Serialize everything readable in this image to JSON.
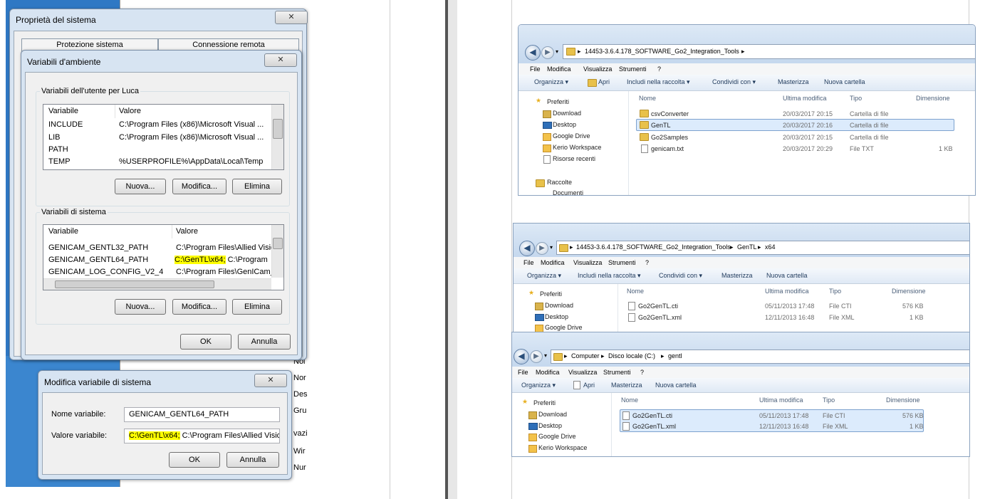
{
  "sysprops": {
    "title": "Proprietà del sistema",
    "close": "✕",
    "tabs": [
      "Protezione sistema",
      "Connessione remota"
    ]
  },
  "envvars": {
    "title": "Variabili d'ambiente",
    "close": "✕",
    "user_group": "Variabili dell'utente per Luca",
    "user_headers": [
      "Variabile",
      "Valore"
    ],
    "user_rows": [
      {
        "name": "INCLUDE",
        "value": "C:\\Program Files (x86)\\Microsoft Visual ..."
      },
      {
        "name": "LIB",
        "value": "C:\\Program Files (x86)\\Microsoft Visual ..."
      },
      {
        "name": "PATH",
        "value": ""
      },
      {
        "name": "TEMP",
        "value": "%USERPROFILE%\\AppData\\Local\\Temp"
      }
    ],
    "user_buttons": [
      "Nuova...",
      "Modifica...",
      "Elimina"
    ],
    "sys_group": "Variabili di sistema",
    "sys_headers": [
      "Variabile",
      "Valore"
    ],
    "sys_rows": [
      {
        "name": "GENICAM_GENTL32_PATH",
        "value": "C:\\Program Files\\Allied Visio"
      },
      {
        "name": "GENICAM_GENTL64_PATH",
        "value_hl": "C:\\GenTL\\x64;",
        "value_rest": " C:\\Program"
      },
      {
        "name": "GENICAM_LOG_CONFIG_V2_4",
        "value": "C:\\Program Files\\GenICam_"
      }
    ],
    "sys_buttons": [
      "Nuova...",
      "Modifica...",
      "Elimina"
    ],
    "ok": "OK",
    "cancel": "Annulla"
  },
  "editvar": {
    "title": "Modifica variabile di sistema",
    "close": "✕",
    "name_label": "Nome variabile:",
    "name_value": "GENICAM_GENTL64_PATH",
    "value_label": "Valore variabile:",
    "value_hl": "C:\\GenTL\\x64;",
    "value_rest": " C:\\Program Files\\Allied Vision",
    "ok": "OK",
    "cancel": "Annulla"
  },
  "side_words": [
    "Noi",
    "Nor",
    "Des",
    "Gru",
    "vazi",
    "Wir",
    "Nur"
  ],
  "explorer1": {
    "path": [
      "14453-3.6.4.178_SOFTWARE_Go2_Integration_Tools"
    ],
    "menu": [
      "File",
      "Modifica",
      "Visualizza",
      "Strumenti",
      "?"
    ],
    "toolbar": [
      "Organizza ▾",
      "Apri",
      "Includi nella raccolta ▾",
      "Condividi con ▾",
      "Masterizza",
      "Nuova cartella"
    ],
    "nav": [
      "Preferiti",
      "Download",
      "Desktop",
      "Google Drive",
      "Kerio Workspace",
      "Risorse recenti",
      "Raccolte",
      "Documenti"
    ],
    "headers": [
      "Nome",
      "Ultima modifica",
      "Tipo",
      "Dimensione"
    ],
    "rows": [
      {
        "name": "csvConverter",
        "date": "20/03/2017 20:15",
        "type": "Cartella di file",
        "size": ""
      },
      {
        "name": "GenTL",
        "date": "20/03/2017 20:16",
        "type": "Cartella di file",
        "size": ""
      },
      {
        "name": "Go2Samples",
        "date": "20/03/2017 20:15",
        "type": "Cartella di file",
        "size": ""
      },
      {
        "name": "genicam.txt",
        "date": "20/03/2017 20:29",
        "type": "File TXT",
        "size": "1 KB"
      }
    ]
  },
  "explorer2": {
    "path": [
      "14453-3.6.4.178_SOFTWARE_Go2_Integration_Tools",
      "GenTL",
      "x64"
    ],
    "menu": [
      "File",
      "Modifica",
      "Visualizza",
      "Strumenti",
      "?"
    ],
    "toolbar": [
      "Organizza ▾",
      "Includi nella raccolta ▾",
      "Condividi con ▾",
      "Masterizza",
      "Nuova cartella"
    ],
    "nav": [
      "Preferiti",
      "Download",
      "Desktop",
      "Google Drive"
    ],
    "headers": [
      "Nome",
      "Ultima modifica",
      "Tipo",
      "Dimensione"
    ],
    "rows": [
      {
        "name": "Go2GenTL.cti",
        "date": "05/11/2013 17:48",
        "type": "File CTI",
        "size": "576 KB"
      },
      {
        "name": "Go2GenTL.xml",
        "date": "12/11/2013 16:48",
        "type": "File XML",
        "size": "1 KB"
      }
    ]
  },
  "explorer3": {
    "path": [
      "Computer",
      "Disco locale (C:)",
      "gentl"
    ],
    "menu": [
      "File",
      "Modifica",
      "Visualizza",
      "Strumenti",
      "?"
    ],
    "toolbar": [
      "Organizza ▾",
      "Apri",
      "Masterizza",
      "Nuova cartella"
    ],
    "nav": [
      "Preferiti",
      "Download",
      "Desktop",
      "Google Drive",
      "Kerio Workspace"
    ],
    "headers": [
      "Nome",
      "Ultima modifica",
      "Tipo",
      "Dimensione"
    ],
    "rows": [
      {
        "name": "Go2GenTL.cti",
        "date": "05/11/2013 17:48",
        "type": "File CTI",
        "size": "576 KB"
      },
      {
        "name": "Go2GenTL.xml",
        "date": "12/11/2013 16:48",
        "type": "File XML",
        "size": "1 KB"
      }
    ]
  }
}
